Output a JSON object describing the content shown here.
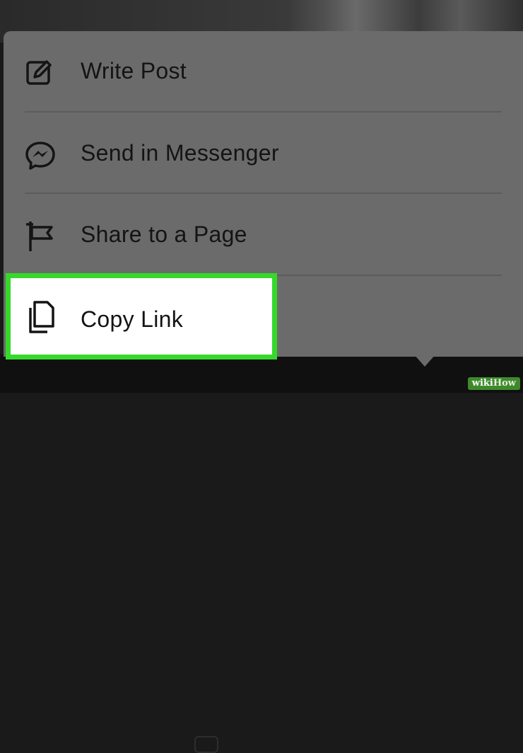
{
  "menu": {
    "items": [
      {
        "label": "Write Post",
        "icon": "edit-icon"
      },
      {
        "label": "Send in Messenger",
        "icon": "messenger-icon"
      },
      {
        "label": "Share to a Page",
        "icon": "flag-icon"
      },
      {
        "label": "Copy Link",
        "icon": "copy-icon",
        "highlighted": true
      }
    ]
  },
  "colors": {
    "sheet": "#6b6b6b",
    "highlight_border": "#35d92a",
    "text": "#141414"
  },
  "watermark": {
    "part1": "wiki",
    "part2": "How"
  }
}
